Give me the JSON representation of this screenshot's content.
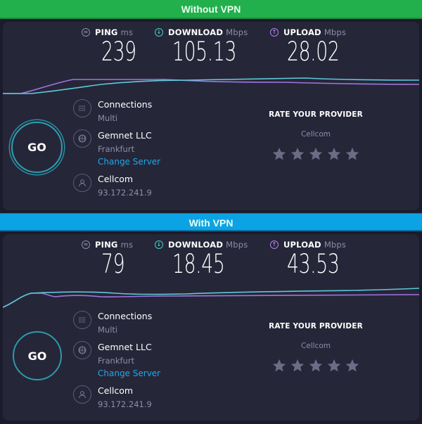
{
  "sections": [
    {
      "banner": "Without VPN",
      "banner_color": "#22b04d",
      "ping": {
        "label": "PING",
        "unit": "ms",
        "value": "239"
      },
      "download": {
        "label": "DOWNLOAD",
        "unit": "Mbps",
        "value": "105.13"
      },
      "upload": {
        "label": "UPLOAD",
        "unit": "Mbps",
        "value": "28.02"
      },
      "go_label": "GO",
      "connections": {
        "title": "Connections",
        "value": "Multi"
      },
      "server": {
        "title": "Gemnet LLC",
        "location": "Frankfurt",
        "change_link": "Change Server"
      },
      "provider": {
        "title": "Cellcom",
        "ip": "93.172.241.9"
      },
      "rate": {
        "title": "RATE YOUR PROVIDER",
        "provider": "Cellcom",
        "stars": 5,
        "rating": 0
      }
    },
    {
      "banner": "With VPN",
      "banner_color": "#0ca3e4",
      "ping": {
        "label": "PING",
        "unit": "ms",
        "value": "79"
      },
      "download": {
        "label": "DOWNLOAD",
        "unit": "Mbps",
        "value": "18.45"
      },
      "upload": {
        "label": "UPLOAD",
        "unit": "Mbps",
        "value": "43.53"
      },
      "go_label": "GO",
      "connections": {
        "title": "Connections",
        "value": "Multi"
      },
      "server": {
        "title": "Gemnet LLC",
        "location": "Frankfurt",
        "change_link": "Change Server"
      },
      "provider": {
        "title": "Cellcom",
        "ip": "93.172.241.9"
      },
      "rate": {
        "title": "RATE YOUR PROVIDER",
        "provider": "Cellcom",
        "stars": 5,
        "rating": 0
      }
    }
  ],
  "colors": {
    "download": "#3fd0c4",
    "upload": "#b37df2",
    "link": "#1ea7e8"
  },
  "icons": {
    "ping": "ping-icon",
    "download": "download-arrow-icon",
    "upload": "upload-arrow-icon",
    "connections": "connections-icon",
    "server": "globe-icon",
    "provider": "user-icon",
    "star": "star-icon"
  }
}
